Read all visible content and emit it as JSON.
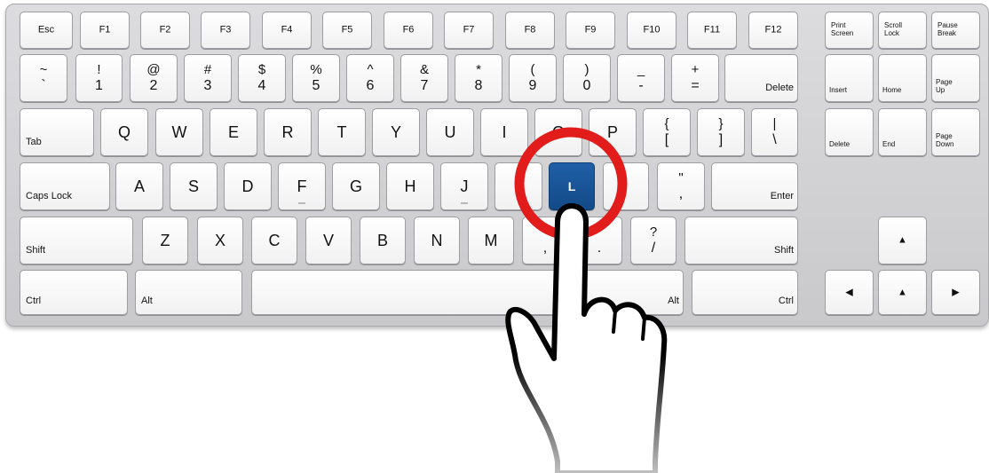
{
  "keyboard": {
    "rows": [
      {
        "name": "function-row",
        "keys": [
          {
            "id": "esc",
            "label": "Esc",
            "style": "fn"
          },
          {
            "id": "f1",
            "label": "F1",
            "style": "fn"
          },
          {
            "id": "f2",
            "label": "F2",
            "style": "fn"
          },
          {
            "id": "f3",
            "label": "F3",
            "style": "fn"
          },
          {
            "id": "f4",
            "label": "F4",
            "style": "fn"
          },
          {
            "id": "f5",
            "label": "F5",
            "style": "fn"
          },
          {
            "id": "f6",
            "label": "F6",
            "style": "fn"
          },
          {
            "id": "f7",
            "label": "F7",
            "style": "fn"
          },
          {
            "id": "f8",
            "label": "F8",
            "style": "fn"
          },
          {
            "id": "f9",
            "label": "F9",
            "style": "fn"
          },
          {
            "id": "f10",
            "label": "F10",
            "style": "fn"
          },
          {
            "id": "f11",
            "label": "F11",
            "style": "fn"
          },
          {
            "id": "f12",
            "label": "F12",
            "style": "fn"
          },
          {
            "id": "print-screen",
            "label": "Print\nScreen",
            "style": "navtop"
          },
          {
            "id": "scroll-lock",
            "label": "Scroll\nLock",
            "style": "navtop"
          },
          {
            "id": "pause-break",
            "label": "Pause\nBreak",
            "style": "navtop"
          }
        ]
      },
      {
        "name": "number-row",
        "keys": [
          {
            "id": "tilde",
            "top": "~",
            "bottom": "`",
            "style": "dual"
          },
          {
            "id": "1",
            "top": "!",
            "bottom": "1",
            "style": "dual"
          },
          {
            "id": "2",
            "top": "@",
            "bottom": "2",
            "style": "dual"
          },
          {
            "id": "3",
            "top": "#",
            "bottom": "3",
            "style": "dual"
          },
          {
            "id": "4",
            "top": "$",
            "bottom": "4",
            "style": "dual"
          },
          {
            "id": "5",
            "top": "%",
            "bottom": "5",
            "style": "dual"
          },
          {
            "id": "6",
            "top": "^",
            "bottom": "6",
            "style": "dual"
          },
          {
            "id": "7",
            "top": "&",
            "bottom": "7",
            "style": "dual"
          },
          {
            "id": "8",
            "top": "*",
            "bottom": "8",
            "style": "dual"
          },
          {
            "id": "9",
            "top": "(",
            "bottom": "9",
            "style": "dual"
          },
          {
            "id": "0",
            "top": ")",
            "bottom": "0",
            "style": "dual"
          },
          {
            "id": "minus",
            "top": "_",
            "bottom": "-",
            "style": "dual"
          },
          {
            "id": "equals",
            "top": "+",
            "bottom": "=",
            "style": "dual"
          },
          {
            "id": "backspace",
            "label": "Delete",
            "style": "br"
          },
          {
            "id": "insert",
            "label": "Insert",
            "style": "nav"
          },
          {
            "id": "home",
            "label": "Home",
            "style": "nav"
          },
          {
            "id": "page-up",
            "label": "Page\nUp",
            "style": "nav"
          }
        ]
      },
      {
        "name": "qwerty-row",
        "keys": [
          {
            "id": "tab",
            "label": "Tab",
            "style": "bl"
          },
          {
            "id": "q",
            "label": "Q",
            "style": "center"
          },
          {
            "id": "w",
            "label": "W",
            "style": "center"
          },
          {
            "id": "e",
            "label": "E",
            "style": "center"
          },
          {
            "id": "r",
            "label": "R",
            "style": "center"
          },
          {
            "id": "t",
            "label": "T",
            "style": "center"
          },
          {
            "id": "y",
            "label": "Y",
            "style": "center"
          },
          {
            "id": "u",
            "label": "U",
            "style": "center"
          },
          {
            "id": "i",
            "label": "I",
            "style": "center"
          },
          {
            "id": "o",
            "label": "O",
            "style": "center"
          },
          {
            "id": "p",
            "label": "P",
            "style": "center"
          },
          {
            "id": "left-bracket",
            "top": "{",
            "bottom": "[",
            "style": "dual"
          },
          {
            "id": "right-bracket",
            "top": "}",
            "bottom": "]",
            "style": "dual"
          },
          {
            "id": "backslash",
            "top": "|",
            "bottom": "\\",
            "style": "dual"
          },
          {
            "id": "delete",
            "label": "Delete",
            "style": "nav"
          },
          {
            "id": "end",
            "label": "End",
            "style": "nav"
          },
          {
            "id": "page-down",
            "label": "Page\nDown",
            "style": "nav"
          }
        ]
      },
      {
        "name": "home-row",
        "keys": [
          {
            "id": "caps-lock",
            "label": "Caps Lock",
            "style": "bl"
          },
          {
            "id": "a",
            "label": "A",
            "style": "center"
          },
          {
            "id": "s",
            "label": "S",
            "style": "center"
          },
          {
            "id": "d",
            "label": "D",
            "style": "center"
          },
          {
            "id": "f",
            "label": "F",
            "style": "center",
            "bump": true
          },
          {
            "id": "g",
            "label": "G",
            "style": "center"
          },
          {
            "id": "h",
            "label": "H",
            "style": "center"
          },
          {
            "id": "j",
            "label": "J",
            "style": "center",
            "bump": true
          },
          {
            "id": "k",
            "label": "",
            "style": "center"
          },
          {
            "id": "l",
            "label": "L",
            "style": "center",
            "active": true
          },
          {
            "id": "semicolon",
            "label": "",
            "style": "center"
          },
          {
            "id": "quote",
            "top": "\"",
            "bottom": ",",
            "style": "dual"
          },
          {
            "id": "enter",
            "label": "Enter",
            "style": "br"
          }
        ]
      },
      {
        "name": "bottom-letter-row",
        "keys": [
          {
            "id": "left-shift",
            "label": "Shift",
            "style": "bl"
          },
          {
            "id": "z",
            "label": "Z",
            "style": "center"
          },
          {
            "id": "x",
            "label": "X",
            "style": "center"
          },
          {
            "id": "c",
            "label": "C",
            "style": "center"
          },
          {
            "id": "v",
            "label": "V",
            "style": "center"
          },
          {
            "id": "b",
            "label": "B",
            "style": "center"
          },
          {
            "id": "n",
            "label": "N",
            "style": "center"
          },
          {
            "id": "m",
            "label": "M",
            "style": "center"
          },
          {
            "id": "comma",
            "top": "",
            "bottom": ",",
            "style": "dual"
          },
          {
            "id": "period",
            "top": "",
            "bottom": ".",
            "style": "dual"
          },
          {
            "id": "slash",
            "top": "?",
            "bottom": "/",
            "style": "dual"
          },
          {
            "id": "right-shift",
            "label": "Shift",
            "style": "br"
          },
          {
            "id": "arrow-up",
            "label": "▲",
            "style": "arrow"
          }
        ]
      },
      {
        "name": "space-row",
        "keys": [
          {
            "id": "left-ctrl",
            "label": "Ctrl",
            "style": "bl"
          },
          {
            "id": "left-alt",
            "label": "Alt",
            "style": "bl"
          },
          {
            "id": "space",
            "label": "",
            "style": "center"
          },
          {
            "id": "right-alt",
            "label": "Alt",
            "style": "br"
          },
          {
            "id": "right-ctrl",
            "label": "Ctrl",
            "style": "br"
          },
          {
            "id": "arrow-left",
            "label": "◀",
            "style": "arrow"
          },
          {
            "id": "arrow-up-small",
            "label": "▲",
            "style": "arrow"
          },
          {
            "id": "arrow-right",
            "label": "▶",
            "style": "arrow"
          }
        ]
      }
    ]
  },
  "highlight": {
    "key_id": "l",
    "ring_color": "#e21b1b",
    "active_key_color": "#1a5598"
  },
  "icons": {
    "pointer": "pointing-hand-icon",
    "ring": "highlight-ring-icon"
  }
}
